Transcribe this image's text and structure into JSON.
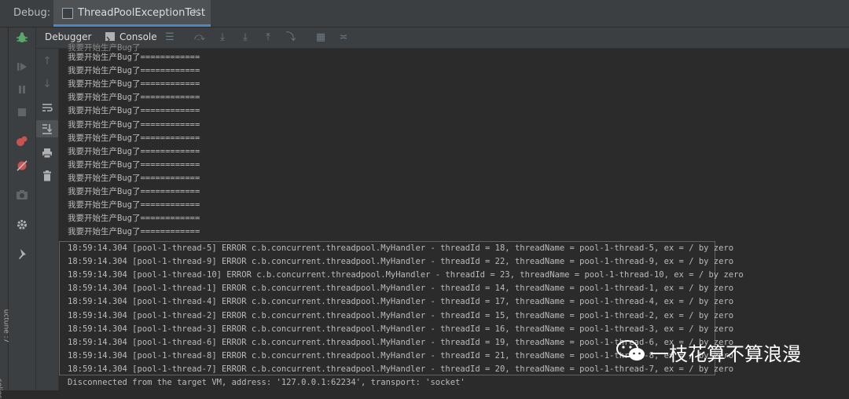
{
  "header": {
    "debug_label": "Debug:",
    "run_tab_title": "ThreadPoolExceptionTest",
    "close_glyph": "×"
  },
  "toolbar": {
    "debugger_label": "Debugger",
    "console_label": "Console"
  },
  "console": {
    "partial_top": "我要开始生产Bug了",
    "repeat_line": "我要开始生产Bug了============",
    "repeat_count": 14,
    "error_lines": [
      "18:59:14.304 [pool-1-thread-5] ERROR c.b.concurrent.threadpool.MyHandler - threadId = 18, threadName = pool-1-thread-5, ex = / by zero",
      "18:59:14.304 [pool-1-thread-9] ERROR c.b.concurrent.threadpool.MyHandler - threadId = 22, threadName = pool-1-thread-9, ex = / by zero",
      "18:59:14.304 [pool-1-thread-10] ERROR c.b.concurrent.threadpool.MyHandler - threadId = 23, threadName = pool-1-thread-10, ex = / by zero",
      "18:59:14.304 [pool-1-thread-1] ERROR c.b.concurrent.threadpool.MyHandler - threadId = 14, threadName = pool-1-thread-1, ex = / by zero",
      "18:59:14.304 [pool-1-thread-4] ERROR c.b.concurrent.threadpool.MyHandler - threadId = 17, threadName = pool-1-thread-4, ex = / by zero",
      "18:59:14.304 [pool-1-thread-2] ERROR c.b.concurrent.threadpool.MyHandler - threadId = 15, threadName = pool-1-thread-2, ex = / by zero",
      "18:59:14.304 [pool-1-thread-3] ERROR c.b.concurrent.threadpool.MyHandler - threadId = 16, threadName = pool-1-thread-3, ex = / by zero",
      "18:59:14.304 [pool-1-thread-6] ERROR c.b.concurrent.threadpool.MyHandler - threadId = 19, threadName = pool-1-thread-6, ex = / by zero",
      "18:59:14.304 [pool-1-thread-8] ERROR c.b.concurrent.threadpool.MyHandler - threadId = 21, threadName = pool-1-thread-8, ex = / by zero",
      "18:59:14.304 [pool-1-thread-7] ERROR c.b.concurrent.threadpool.MyHandler - threadId = 20, threadName = pool-1-thread-7, ex = / by zero"
    ],
    "disconnect_line": "Disconnected from the target VM, address: '127.0.0.1:62234', transport: 'socket'"
  },
  "left_strip": {
    "label_1": "uctune :7",
    "label_2": "solies"
  },
  "watermark": {
    "text": "一枝花算不算浪漫"
  },
  "colors": {
    "error_box": "#d9312d",
    "accent": "#4a88c7",
    "bug_green": "#59a869",
    "resume_red": "#c75450"
  }
}
